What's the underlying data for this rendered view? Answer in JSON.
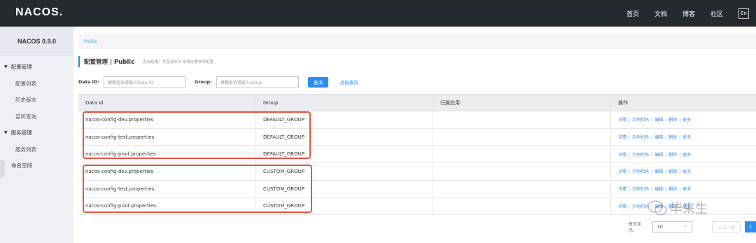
{
  "app": {
    "logo": "NACOS."
  },
  "topnav": {
    "items": [
      "首页",
      "文档",
      "博客",
      "社区"
    ],
    "lang": "En"
  },
  "sidebar": {
    "version": "NACOS 0.9.0",
    "config_group": "配置管理",
    "config_items": [
      "配置列表",
      "历史版本",
      "监听查询"
    ],
    "service_group": "服务管理",
    "service_items": [
      "服务列表"
    ],
    "namespace": "命名空间"
  },
  "breadcrumb": "Public",
  "page": {
    "title": "配置管理  |  Public",
    "hint": "查询结果：共查询到 6 条满足要求的配置。"
  },
  "filters": {
    "dataid_label": "Data ID:",
    "dataid_placeholder": "模糊查询请输入Data ID",
    "group_label": "Group:",
    "group_placeholder": "模糊查询请输入Group",
    "query_label": "查询",
    "advanced_label": "高级查询"
  },
  "table": {
    "headers": [
      "Data Id",
      "Group",
      "归属应用:",
      "操作"
    ],
    "rows": [
      {
        "data_id": "nacos-config-dev.properties",
        "group": "DEFAULT_GROUP",
        "app": ""
      },
      {
        "data_id": "nacos-config-test.properties",
        "group": "DEFAULT_GROUP",
        "app": ""
      },
      {
        "data_id": "nacos-config-prod.properties",
        "group": "DEFAULT_GROUP",
        "app": ""
      },
      {
        "data_id": "nacos-config-dev.properties",
        "group": "CUSTOM_GROUP",
        "app": ""
      },
      {
        "data_id": "nacos-config-test.properties",
        "group": "CUSTOM_GROUP",
        "app": ""
      },
      {
        "data_id": "nacos-config-prod.properties",
        "group": "CUSTOM_GROUP",
        "app": ""
      }
    ],
    "ops": [
      "详情",
      "示例代码",
      "编辑",
      "删除",
      "更多"
    ]
  },
  "pager": {
    "label": "每页显示:",
    "page_size": "10",
    "prev": "< 上一页",
    "current": "1"
  },
  "watermark": "毕来生",
  "colors": {
    "accent": "#2d8cf0",
    "topbar": "#252a2f",
    "highlight": "#e2553d"
  }
}
